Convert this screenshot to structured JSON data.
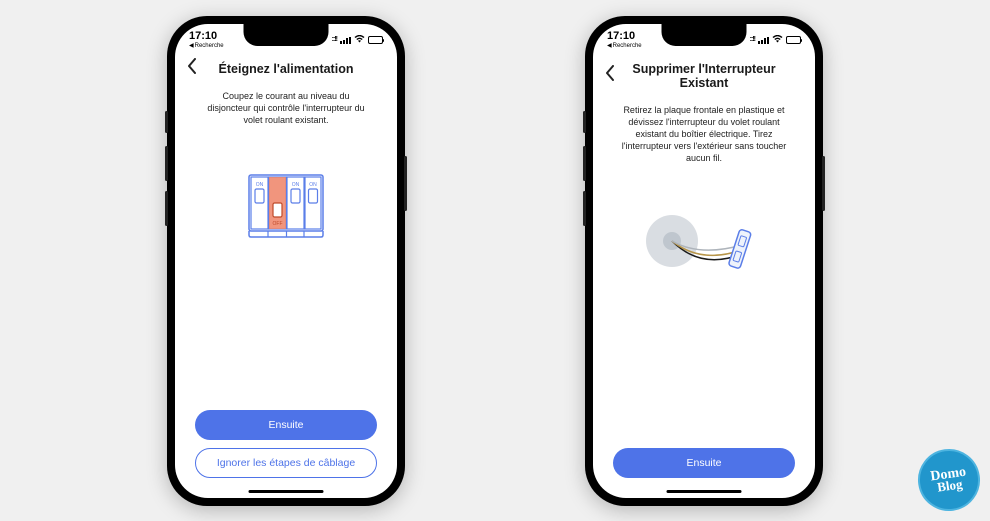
{
  "status": {
    "time": "17:10",
    "back_label": "Recherche",
    "signal_indicator": "::!!"
  },
  "screens": [
    {
      "title": "Éteignez l'alimentation",
      "description": "Coupez le courant au niveau du disjoncteur qui contrôle l'interrupteur du volet roulant existant.",
      "primary_button": "Ensuite",
      "secondary_button": "Ignorer les étapes de câblage",
      "has_secondary": true,
      "illustration": "circuit-breaker",
      "breaker": {
        "on_label": "ON",
        "off_label": "OFF"
      }
    },
    {
      "title": "Supprimer l'Interrupteur Existant",
      "description": "Retirez la plaque frontale en plastique et dévissez l'interrupteur du volet roulant existant du boîtier électrique. Tirez l'interrupteur vers l'extérieur sans toucher aucun fil.",
      "primary_button": "Ensuite",
      "has_secondary": false,
      "illustration": "remove-switch"
    }
  ],
  "logo": {
    "line1": "Domo",
    "line2": "Blog"
  }
}
